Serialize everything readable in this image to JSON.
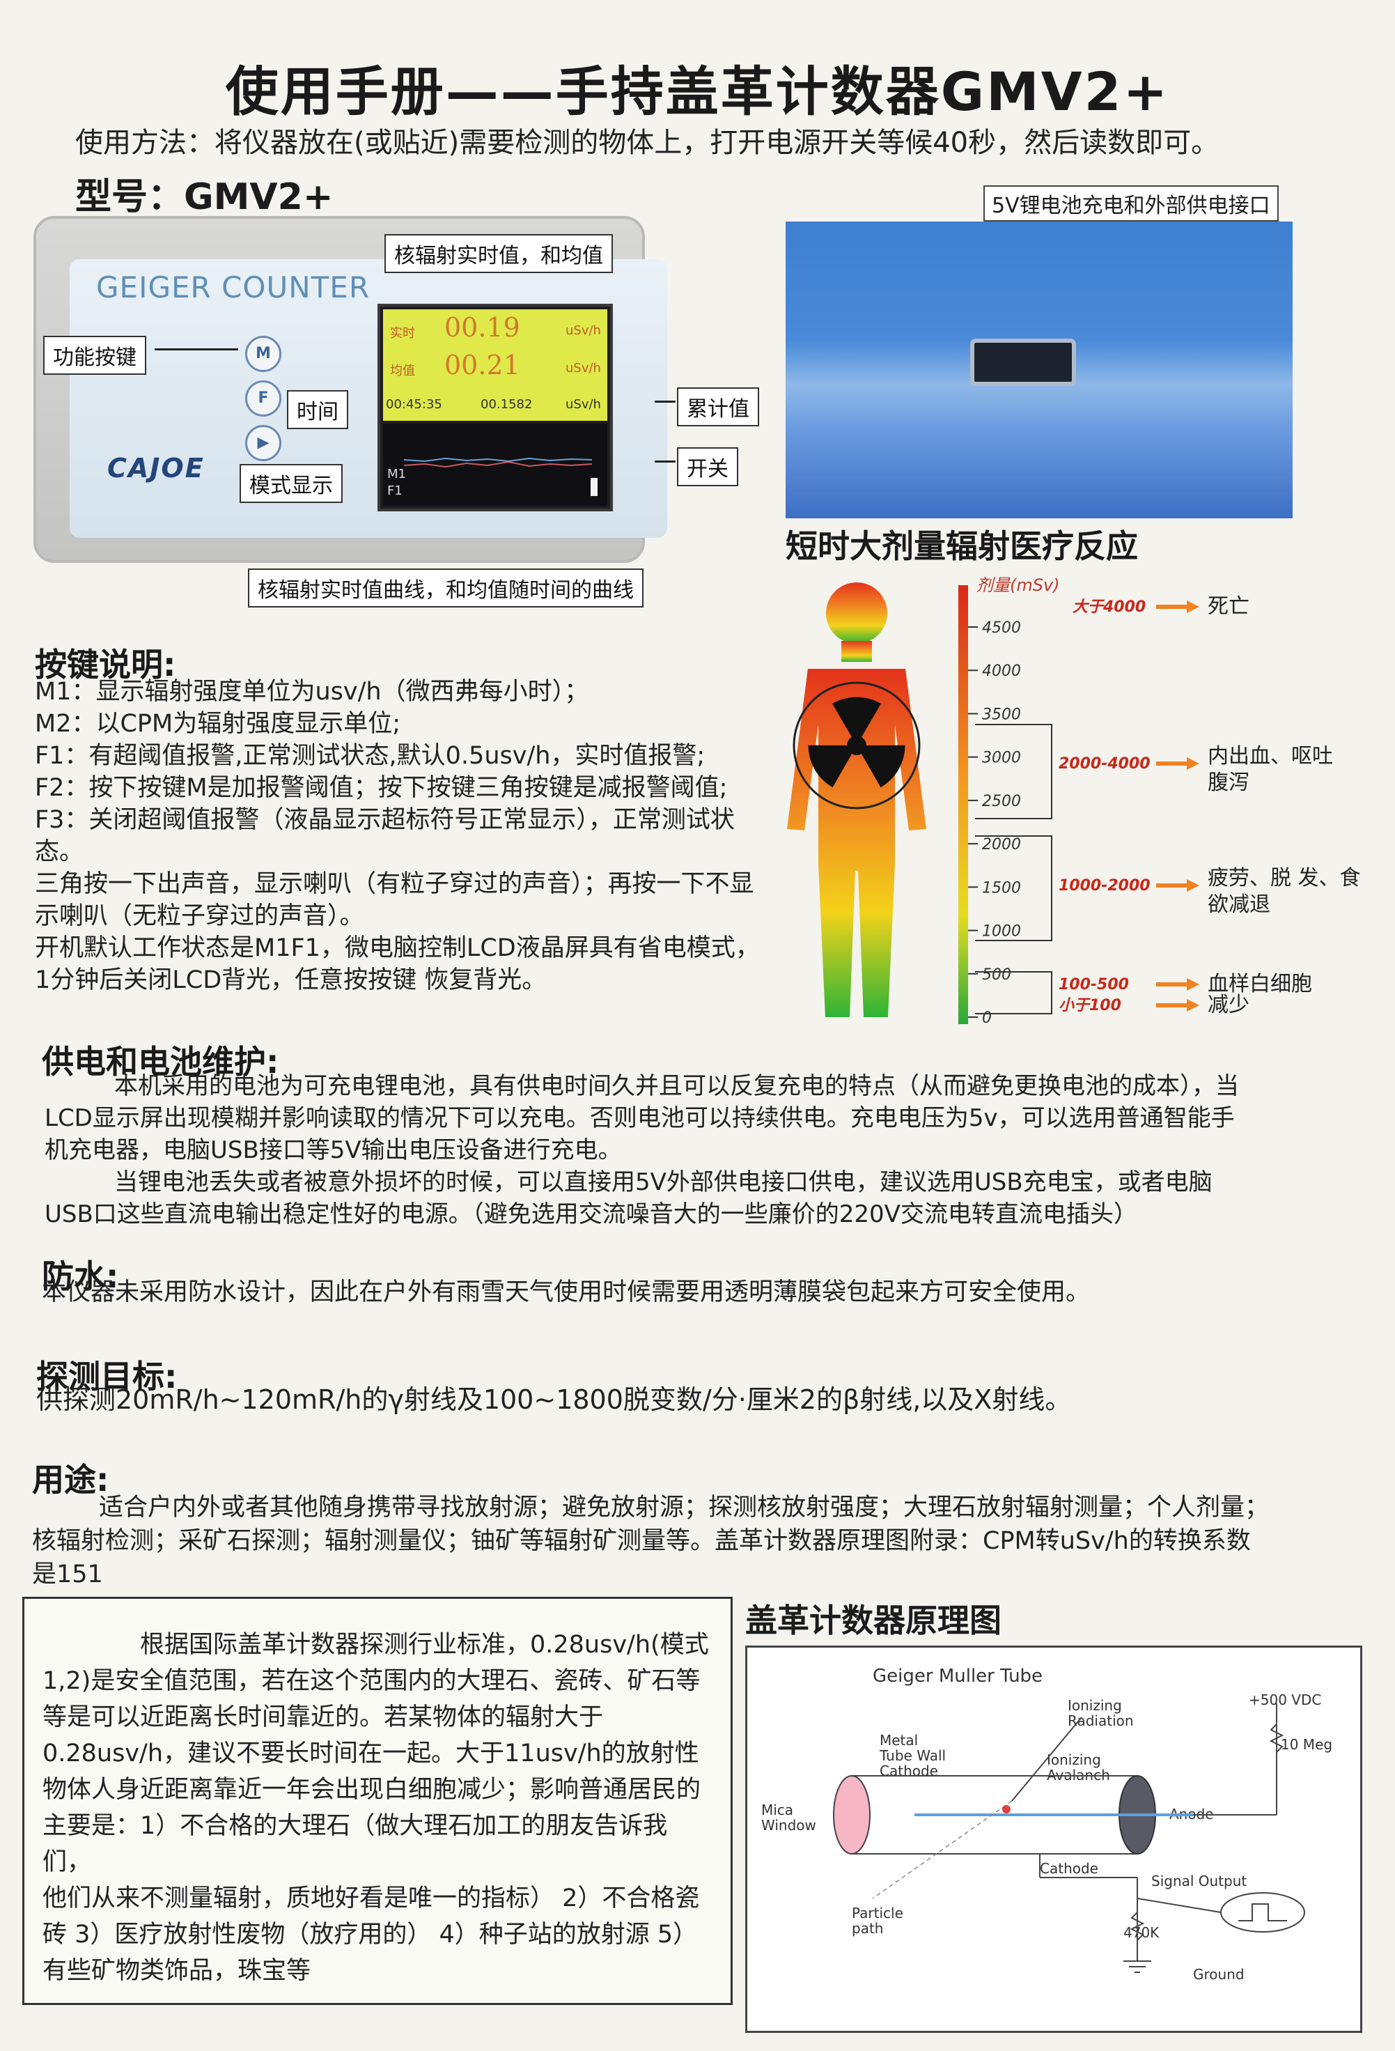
{
  "title": "使用手册——手持盖革计数器GMV2+",
  "usage": "使用方法：将仪器放在(或贴近)需要检测的物体上，打开电源开关等候40秒，然后读数即可。",
  "model": "型号：GMV2+",
  "device": {
    "screen_label": "GEIGER COUNTER",
    "brand": "CAJOE",
    "buttons": [
      "M",
      "F",
      "▶"
    ],
    "lcd": {
      "row1_label": "实时",
      "row1_value": "00.19",
      "row2_label": "均值",
      "row2_value": "00.21",
      "row3_left": "00:45:35",
      "row3_mid": "00.1582",
      "unit": "uSv/h",
      "bottom_mode": "M1",
      "bottom_mode2": "F1"
    },
    "callouts": {
      "realtime_avg": "核辐射实时值，和均值",
      "function_key": "功能按键",
      "time": "时间",
      "mode_display": "模式显示",
      "cumulative": "累计值",
      "switch": "开关",
      "curve": "核辐射实时值曲线，和均值随时间的曲线"
    }
  },
  "usb_photo": {
    "callout": "5V锂电池充电和外部供电接口"
  },
  "dose_chart": {
    "title": "短时大剂量辐射医疗反应",
    "axis_label": "剂量(mSv)",
    "ticks": [
      "4500",
      "4000",
      "3500",
      "3000",
      "2500",
      "2000",
      "1500",
      "1000",
      "500",
      "0"
    ],
    "effects": [
      {
        "range": "大于4000",
        "effect": "死亡"
      },
      {
        "range": "2000-4000",
        "effect": "内出血、呕吐腹泻"
      },
      {
        "range": "1000-2000",
        "effect": "疲劳、脱 发、食欲减退"
      },
      {
        "range": "100-500",
        "effect": "血样白细胞"
      },
      {
        "range": "小于100",
        "effect": "减少"
      }
    ]
  },
  "keys": {
    "heading": "按键说明:",
    "lines": [
      "M1：显示辐射强度单位为usv/h（微西弗每小时）；",
      "M2：以CPM为辐射强度显示单位;",
      "F1：有超阈值报警,正常测试状态,默认0.5usv/h，实时值报警;",
      "F2：按下按键M是加报警阈值；按下按键三角按键是减报警阈值;",
      "F3：关闭超阈值报警（液晶显示超标符号正常显示），正常测试状",
      "态。",
      "三角按一下出声音，显示喇叭（有粒子穿过的声音）；再按一下不显",
      "示喇叭（无粒子穿过的声音）。",
      "开机默认工作状态是M1F1，微电脑控制LCD液晶屏具有省电模式，",
      "1分钟后关闭LCD背光，任意按按键 恢复背光。"
    ]
  },
  "power": {
    "heading": "供电和电池维护:",
    "lines": [
      "本机采用的电池为可充电锂电池，具有供电时间久并且可以反复充电的特点（从而避免更换电池的成本），当",
      "LCD显示屏出现模糊并影响读取的情况下可以充电。否则电池可以持续供电。充电电压为5v，可以选用普通智能手",
      "机充电器，电脑USB接口等5V输出电压设备进行充电。",
      "当锂电池丢失或者被意外损坏的时候，可以直接用5V外部供电接口供电，建议选用USB充电宝，或者电脑",
      "USB口这些直流电输出稳定性好的电源。（避免选用交流噪音大的一些廉价的220V交流电转直流电插头）"
    ]
  },
  "waterproof": {
    "heading": "防水:",
    "text": "本仪器未采用防水设计，因此在户外有雨雪天气使用时候需要用透明薄膜袋包起来方可安全使用。"
  },
  "detect": {
    "heading": "探测目标:",
    "text": "供探测20mR/h~120mR/h的γ射线及100~1800脱变数/分·厘米2的β射线,以及X射线。"
  },
  "purpose": {
    "heading": "用途:",
    "lines": [
      "适合户内外或者其他随身携带寻找放射源；避免放射源；探测核放射强度；大理石放射辐射测量；个人剂量；",
      "核辐射检测；采矿石探测；辐射测量仪；铀矿等辐射矿测量等。盖革计数器原理图附录：CPM转uSv/h的转换系数",
      "是151"
    ]
  },
  "note": {
    "lines": [
      "根据国际盖革计数器探测行业标准，0.28usv/h(模式",
      "1,2)是安全值范围，若在这个范围内的大理石、瓷砖、矿石等",
      "等是可以近距离长时间靠近的。若某物体的辐射大于",
      "0.28usv/h，建议不要长时间在一起。大于11usv/h的放射性",
      "物体人身近距离靠近一年会出现白细胞减少；影响普通居民的",
      "主要是：1）不合格的大理石（做大理石加工的朋友告诉我们，",
      "他们从来不测量辐射，质地好看是唯一的指标） 2）不合格瓷",
      "砖 3）医疗放射性废物（放疗用的） 4）种子站的放射源 5）",
      "有些矿物类饰品，珠宝等"
    ]
  },
  "schematic": {
    "title": "盖革计数器原理图",
    "labels": {
      "tube": "Geiger Muller Tube",
      "ionizing_radiation": "Ionizing\nRadiation",
      "metal": "Metal\nTube Wall\nCathode",
      "avalanche": "Ionizing\nAvalanch",
      "mica": "Mica\nWindow",
      "anode": "Anode",
      "cathode": "Cathode",
      "particle": "Particle\npath",
      "signal": "Signal Output",
      "r470": "470K",
      "ground": "Ground",
      "vdc": "+500 VDC",
      "r10": "10 Meg"
    }
  }
}
